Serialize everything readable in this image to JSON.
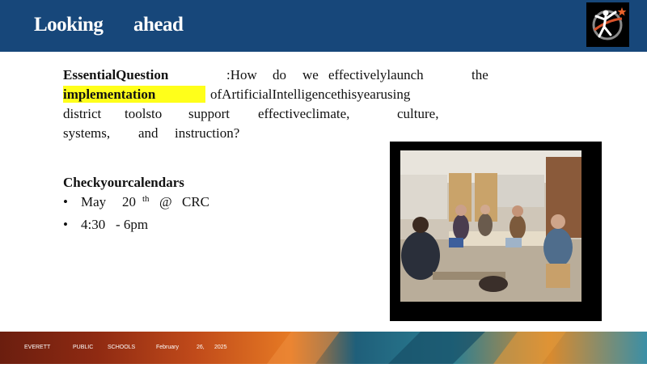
{
  "header": {
    "title_word1": "Looking",
    "title_word2": "ahead"
  },
  "essential": {
    "label": "EssentialQuestion",
    "line1_parts": [
      ":How",
      "do",
      "we",
      "effectivelylaunch",
      "the"
    ],
    "highlight": "implementation",
    "line2_rest": "ofArtificialIntelligencethisyearusing",
    "line3_parts": [
      "district",
      "toolsto",
      "support",
      "effectiveclimate,",
      "culture,"
    ],
    "line4_parts": [
      "systems,",
      "and",
      "instruction?"
    ]
  },
  "calendar": {
    "heading": "Checkyourcalendars",
    "bullet": "•",
    "item1": {
      "month": "May",
      "day": "20",
      "suffix": "th",
      "at": "@",
      "place": "CRC"
    },
    "item2": {
      "start": "4:30",
      "end": "- 6pm"
    }
  },
  "footer": {
    "org_words": [
      "EVERETT",
      "PUBLIC",
      "SCHOOLS"
    ],
    "date_parts": [
      "February",
      "26,",
      "2025"
    ]
  },
  "colors": {
    "header": "#17477a",
    "highlight": "#ffff1a"
  }
}
